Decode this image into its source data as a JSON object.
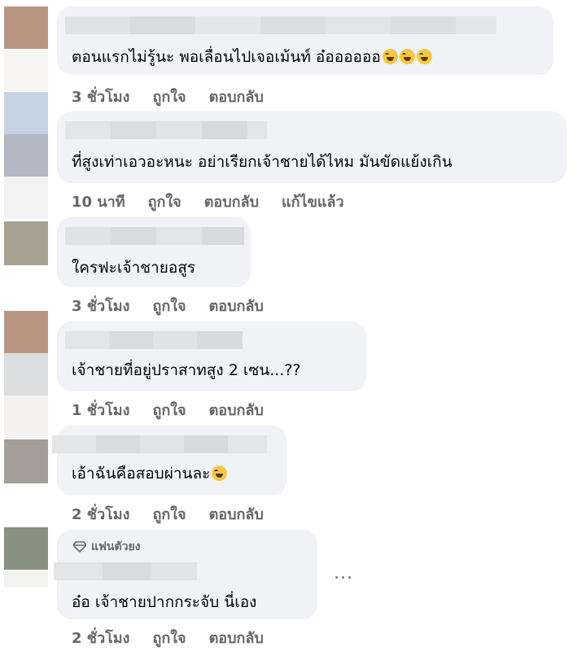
{
  "comments": [
    {
      "text": "ตอนแรกไม่รู้นะ พอเลื่อนไปเจอเม้นท์ อ๋ออออออ",
      "emoji_count": 3,
      "emoji_icon": "rolling-on-floor-laughing",
      "actions": [
        "3 ชั่วโมง",
        "ถูกใจ",
        "ตอบกลับ"
      ]
    },
    {
      "text": "ที่สูงเท่าเอวอะหนะ อย่าเรียกเจ้าชายได้ไหม มันขัดแย้งเกิน",
      "emoji_count": 0,
      "actions": [
        "10 นาที",
        "ถูกใจ",
        "ตอบกลับ",
        "แก้ไขแล้ว"
      ]
    },
    {
      "text": "ใครฟะเจ้าชายอสูร",
      "emoji_count": 0,
      "actions": [
        "3 ชั่วโมง",
        "ถูกใจ",
        "ตอบกลับ"
      ]
    },
    {
      "text": "เจ้าชายที่อยู่ปราสาทสูง 2 เซน...??",
      "emoji_count": 0,
      "actions": [
        "1 ชั่วโมง",
        "ถูกใจ",
        "ตอบกลับ"
      ]
    },
    {
      "text": "เอ้าฉันคือสอบผ่านละ",
      "emoji_count": 1,
      "emoji_icon": "rolling-on-floor-laughing",
      "actions": [
        "2 ชั่วโมง",
        "ถูกใจ",
        "ตอบกลับ"
      ]
    },
    {
      "badge": "แฟนตัวยง",
      "badge_icon": "diamond-icon",
      "text": "อ๋อ เจ้าชายปากกระจับ นี่เอง",
      "emoji_count": 0,
      "actions": [
        "2 ชั่วโมง",
        "ถูกใจ",
        "ตอบกลับ"
      ],
      "more": "..."
    }
  ]
}
